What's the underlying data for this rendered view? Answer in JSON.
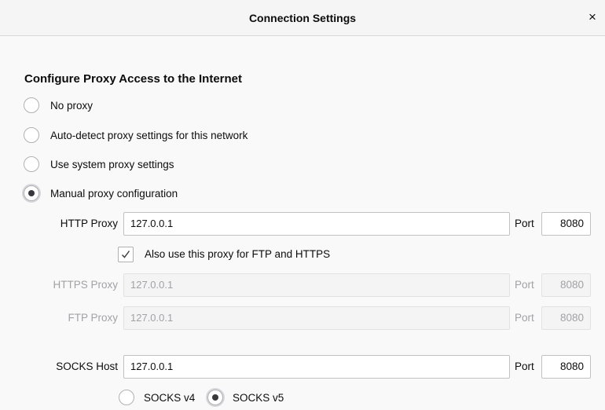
{
  "dialog": {
    "title": "Connection Settings",
    "close_glyph": "×"
  },
  "proxy": {
    "heading": "Configure Proxy Access to the Internet",
    "options": [
      {
        "label": "No proxy",
        "selected": false
      },
      {
        "label": "Auto-detect proxy settings for this network",
        "selected": false
      },
      {
        "label": "Use system proxy settings",
        "selected": false
      },
      {
        "label": "Manual proxy configuration",
        "selected": true
      }
    ]
  },
  "manual": {
    "port_label": "Port",
    "http": {
      "label": "HTTP Proxy",
      "host": "127.0.0.1",
      "port": "8080"
    },
    "share": {
      "label": "Also use this proxy for FTP and HTTPS",
      "checked": true
    },
    "https": {
      "label": "HTTPS Proxy",
      "host": "127.0.0.1",
      "port": "8080"
    },
    "ftp": {
      "label": "FTP Proxy",
      "host": "127.0.0.1",
      "port": "8080"
    },
    "socks": {
      "label": "SOCKS Host",
      "host": "127.0.0.1",
      "port": "8080"
    },
    "socks_versions": [
      {
        "label": "SOCKS v4",
        "selected": false
      },
      {
        "label": "SOCKS v5",
        "selected": true
      }
    ]
  },
  "icons": {
    "close": "close-icon",
    "check": "checkmark-icon"
  }
}
